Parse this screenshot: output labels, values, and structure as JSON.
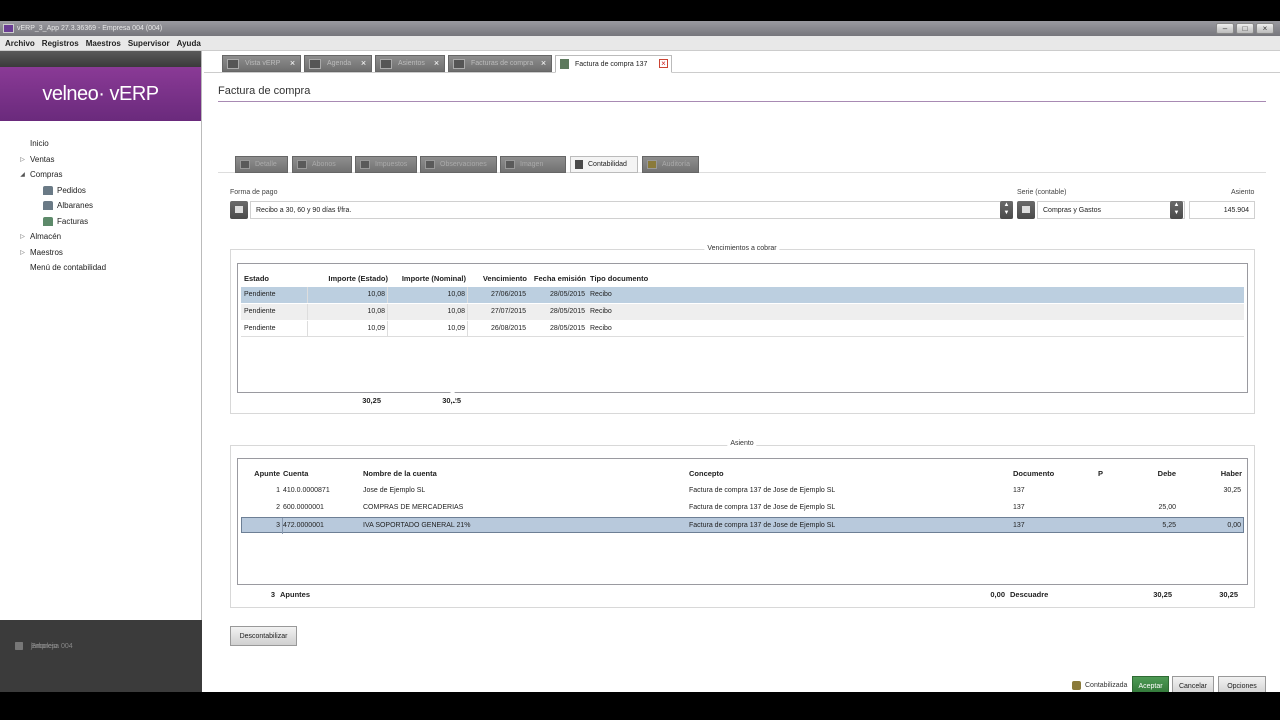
{
  "window": {
    "title": "vERP_3_App 27.3.36369 - Empresa 004 (004)"
  },
  "menu": [
    "Archivo",
    "Registros",
    "Maestros",
    "Supervisor",
    "Ayuda"
  ],
  "sidebar": {
    "logo": "velneo· vERP",
    "nav": [
      {
        "label": "Inicio",
        "tri": ""
      },
      {
        "label": "Ventas",
        "tri": "▷"
      },
      {
        "label": "Compras",
        "tri": "◢"
      },
      {
        "label": "Pedidos",
        "sub": true
      },
      {
        "label": "Albaranes",
        "sub": true
      },
      {
        "label": "Facturas",
        "sub": true
      },
      {
        "label": "Almacén",
        "tri": "▷"
      },
      {
        "label": "Maestros",
        "tri": "▷"
      },
      {
        "label": "Menú de contabilidad",
        "tri": ""
      }
    ],
    "footer": {
      "company": "Empresa 004",
      "user": "jarbolejo"
    }
  },
  "tabs": [
    "Vista vERP",
    "Agenda",
    "Asientos",
    "Facturas de compra",
    "Factura de compra 137"
  ],
  "page_title": "Factura de compra",
  "subtabs": [
    "Detalle",
    "Abonos",
    "Impuestos",
    "Observaciones",
    "Imagen",
    "Contabilidad",
    "Auditoría"
  ],
  "form": {
    "forma_pago_label": "Forma de pago",
    "forma_pago": "Recibo a 30, 60 y 90 días f/fra.",
    "serie_label": "Serie (contable)",
    "serie": "Compras y Gastos",
    "asiento_label": "Asiento",
    "asiento": "145.904"
  },
  "vencimientos": {
    "title": "Vencimientos a cobrar",
    "headers": [
      "Estado",
      "Importe (Estado)",
      "Importe (Nominal)",
      "Vencimiento",
      "Fecha emisión",
      "Tipo documento"
    ],
    "rows": [
      [
        "Pendiente",
        "10,08",
        "10,08",
        "27/06/2015",
        "28/05/2015",
        "Recibo"
      ],
      [
        "Pendiente",
        "10,08",
        "10,08",
        "27/07/2015",
        "28/05/2015",
        "Recibo"
      ],
      [
        "Pendiente",
        "10,09",
        "10,09",
        "26/08/2015",
        "28/05/2015",
        "Recibo"
      ]
    ],
    "total_estado": "30,25",
    "total_nominal": "30,25"
  },
  "asiento": {
    "title": "Asiento",
    "headers": [
      "Apunte",
      "Cuenta",
      "Nombre de la cuenta",
      "Concepto",
      "Documento",
      "P",
      "Debe",
      "Haber"
    ],
    "rows": [
      [
        "1",
        "410.0.0000871",
        "Jose de Ejemplo SL",
        "Factura de compra 137 de Jose de Ejemplo SL",
        "137",
        "",
        "",
        "30,25"
      ],
      [
        "2",
        "600.0000001",
        "COMPRAS DE MERCADERIAS",
        "Factura de compra 137 de Jose de Ejemplo SL",
        "137",
        "",
        "25,00",
        ""
      ],
      [
        "3",
        "472.0000001",
        "IVA SOPORTADO GENERAL 21%",
        "Factura de compra 137 de Jose de Ejemplo SL",
        "137",
        "",
        "5,25",
        "0,00"
      ]
    ],
    "totals": {
      "count": "3",
      "count_label": "Apuntes",
      "descuadre": "0,00",
      "descuadre_label": "Descuadre",
      "debe": "30,25",
      "haber": "30,25"
    }
  },
  "buttons": {
    "descontabilizar": "Descontabilizar",
    "contabilizada": "Contabilizada",
    "aceptar": "Aceptar",
    "cancelar": "Cancelar",
    "opciones": "Opciones"
  }
}
